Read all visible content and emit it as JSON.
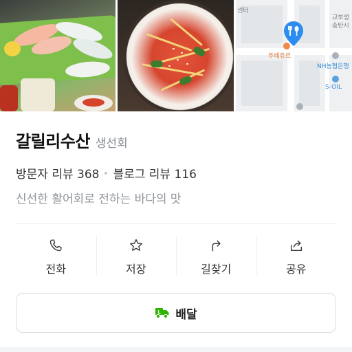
{
  "place": {
    "name": "갈릴리수산",
    "category": "생선회",
    "visitor_review_label": "방문자 리뷰 368",
    "blog_review_label": "블로그 리뷰 116",
    "description": "신선한 활어회로 전하는 바다의 맛"
  },
  "photos": [
    {
      "icon": "sashimi-photo"
    },
    {
      "icon": "spicy-noodle-photo"
    },
    {
      "icon": "map-thumbnail"
    }
  ],
  "map": {
    "labels": {
      "center": "센터",
      "school": "교보생",
      "school2": "송탄시",
      "bakery": "뚜레쥬르",
      "bank": "NH농협은행",
      "oil": "S-OIL"
    },
    "pin_color": "#2d8cf0"
  },
  "actions": [
    {
      "label": "전화",
      "icon": "phone-icon"
    },
    {
      "label": "저장",
      "icon": "star-icon"
    },
    {
      "label": "길찾기",
      "icon": "directions-icon"
    },
    {
      "label": "공유",
      "icon": "share-icon"
    }
  ],
  "delivery": {
    "label": "배달",
    "icon": "delivery-truck-icon",
    "icon_color": "#2db400"
  }
}
